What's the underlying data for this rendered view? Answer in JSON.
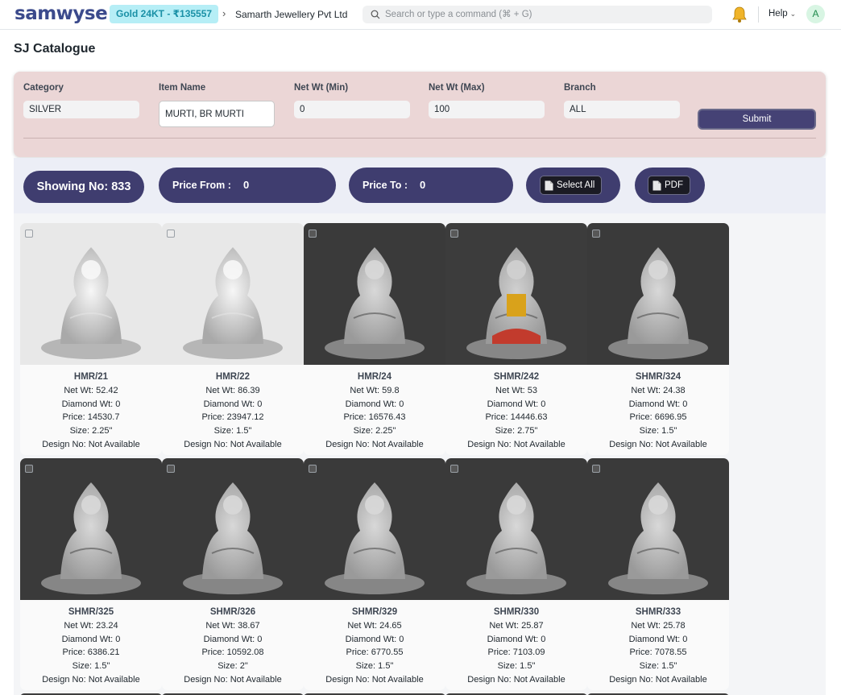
{
  "navbar": {
    "logo": "samwyse",
    "gold_badge": "Gold 24KT - ₹135557",
    "company": "Samarth Jewellery Pvt Ltd",
    "search_placeholder": "Search or type a command (⌘ + G)",
    "help_label": "Help",
    "avatar_initial": "A"
  },
  "page": {
    "title": "SJ Catalogue"
  },
  "filters": {
    "category": {
      "label": "Category",
      "value": "SILVER"
    },
    "item_name": {
      "label": "Item Name",
      "value": "MURTI, BR MURTI"
    },
    "net_wt_min": {
      "label": "Net Wt (Min)",
      "value": "0"
    },
    "net_wt_max": {
      "label": "Net Wt (Max)",
      "value": "100"
    },
    "branch": {
      "label": "Branch",
      "value": "ALL"
    },
    "submit_label": "Submit"
  },
  "summary": {
    "showing": "Showing No: 833",
    "price_from_label": "Price From :",
    "price_from_value": "0",
    "price_to_label": "Price To :",
    "price_to_value": "0",
    "select_all_label": "Select All",
    "pdf_label": "PDF"
  },
  "colors": {
    "primary": "#3f3d6f",
    "filter_bg": "#ebd6d6",
    "gold_badge_bg": "#b6eef6"
  },
  "items": [
    {
      "code": "HMR/21",
      "net_wt": "Net Wt: 52.42",
      "diamond_wt": "Diamond Wt: 0",
      "price": "Price: 14530.7",
      "size": "Size: 2.25\"",
      "design_no": "Design No: Not Available",
      "tone": "light"
    },
    {
      "code": "HMR/22",
      "net_wt": "Net Wt: 86.39",
      "diamond_wt": "Diamond Wt: 0",
      "price": "Price: 23947.12",
      "size": "Size: 1.5\"",
      "design_no": "Design No: Not Available",
      "tone": "light"
    },
    {
      "code": "HMR/24",
      "net_wt": "Net Wt: 59.8",
      "diamond_wt": "Diamond Wt: 0",
      "price": "Price: 16576.43",
      "size": "Size: 2.25\"",
      "design_no": "Design No: Not Available",
      "tone": "dark"
    },
    {
      "code": "SHMR/242",
      "net_wt": "Net Wt: 53",
      "diamond_wt": "Diamond Wt: 0",
      "price": "Price: 14446.63",
      "size": "Size: 2.75\"",
      "design_no": "Design No: Not Available",
      "tone": "color"
    },
    {
      "code": "SHMR/324",
      "net_wt": "Net Wt: 24.38",
      "diamond_wt": "Diamond Wt: 0",
      "price": "Price: 6696.95",
      "size": "Size: 1.5\"",
      "design_no": "Design No: Not Available",
      "tone": "dark"
    },
    {
      "code": "SHMR/325",
      "net_wt": "Net Wt: 23.24",
      "diamond_wt": "Diamond Wt: 0",
      "price": "Price: 6386.21",
      "size": "Size: 1.5\"",
      "design_no": "Design No: Not Available",
      "tone": "dark"
    },
    {
      "code": "SHMR/326",
      "net_wt": "Net Wt: 38.67",
      "diamond_wt": "Diamond Wt: 0",
      "price": "Price: 10592.08",
      "size": "Size: 2\"",
      "design_no": "Design No: Not Available",
      "tone": "dark"
    },
    {
      "code": "SHMR/329",
      "net_wt": "Net Wt: 24.65",
      "diamond_wt": "Diamond Wt: 0",
      "price": "Price: 6770.55",
      "size": "Size: 1.5\"",
      "design_no": "Design No: Not Available",
      "tone": "dark"
    },
    {
      "code": "SHMR/330",
      "net_wt": "Net Wt: 25.87",
      "diamond_wt": "Diamond Wt: 0",
      "price": "Price: 7103.09",
      "size": "Size: 1.5\"",
      "design_no": "Design No: Not Available",
      "tone": "dark"
    },
    {
      "code": "SHMR/333",
      "net_wt": "Net Wt: 25.78",
      "diamond_wt": "Diamond Wt: 0",
      "price": "Price: 7078.55",
      "size": "Size: 1.5\"",
      "design_no": "Design No: Not Available",
      "tone": "dark"
    }
  ]
}
